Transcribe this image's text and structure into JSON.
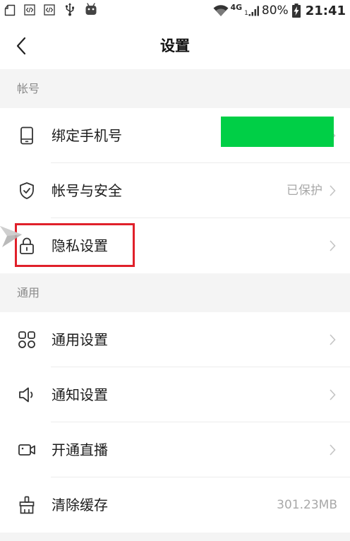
{
  "status_bar": {
    "left_icons": [
      "file-notification-icon",
      "code-icon",
      "code-icon",
      "usb-icon",
      "android-icon"
    ],
    "right_icons": [
      "wifi-icon",
      "signal-icon",
      "battery-charging-icon"
    ],
    "network_type": "4G",
    "sim_slot": "1",
    "battery_percent": "80%",
    "time": "21:41"
  },
  "header": {
    "back_icon": "chevron-left-icon",
    "title": "设置"
  },
  "sections": [
    {
      "title": "帐号",
      "items": [
        {
          "icon": "phone-icon",
          "label": "绑定手机号"
        },
        {
          "icon": "shield-icon",
          "label": "帐号与安全",
          "value": "已保护"
        },
        {
          "icon": "lock-icon",
          "label": "隐私设置"
        }
      ]
    },
    {
      "title": "通用",
      "items": [
        {
          "icon": "grid-icon",
          "label": "通用设置"
        },
        {
          "icon": "speaker-icon",
          "label": "通知设置"
        },
        {
          "icon": "video-camera-icon",
          "label": "开通直播"
        },
        {
          "icon": "brush-icon",
          "label": "清除缓存",
          "value": "301.23MB"
        }
      ]
    }
  ],
  "theme": {
    "highlight_box": "#e0202a",
    "redaction_box": "#00cf46",
    "section_band": "#f4f4f4",
    "pointer": "#b3b3b3",
    "chevron": "#c4c4c4",
    "secondary_text": "#a8a8a8"
  }
}
